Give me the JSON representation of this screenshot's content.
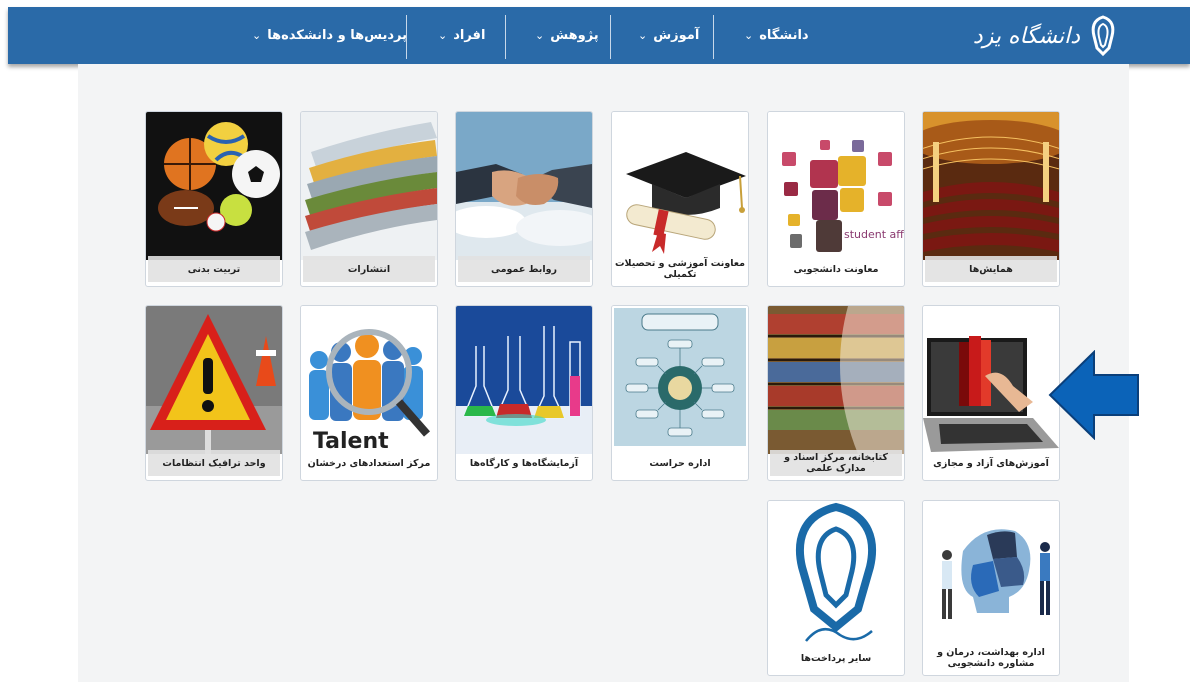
{
  "header": {
    "logo_text": "دانشگاه یزد",
    "nav": [
      {
        "label": "دانشگاه"
      },
      {
        "label": "آموزش"
      },
      {
        "label": "پژوهش"
      },
      {
        "label": "افراد"
      },
      {
        "label": "پردیس‌ها و دانشکده‌ها"
      }
    ]
  },
  "tiles": [
    {
      "label": "همایش‌ها",
      "icon": "auditorium-image"
    },
    {
      "label": "معاونت دانشجویی",
      "icon": "student-affairs-image",
      "caption": "student affairs"
    },
    {
      "label": "معاونت آموزشی و تحصیلات تکمیلی",
      "icon": "graduation-cap-image"
    },
    {
      "label": "روابط عمومی",
      "icon": "handshake-image"
    },
    {
      "label": "انتشارات",
      "icon": "magazines-image"
    },
    {
      "label": "تربیت بدنی",
      "icon": "sports-balls-image"
    },
    {
      "label": "آموزش‌های آزاد و مجازی",
      "icon": "laptop-book-image"
    },
    {
      "label": "کتابخانه، مرکز اسناد و مدارک علمی",
      "icon": "library-image"
    },
    {
      "label": "اداره حراست",
      "icon": "ornament-image"
    },
    {
      "label": "آزمایشگاه‌ها و کارگاه‌ها",
      "icon": "lab-flasks-image"
    },
    {
      "label": "مرکز استعدادهای درخشان",
      "icon": "talent-image",
      "caption": "Talent"
    },
    {
      "label": "واحد ترافیک انتظامات",
      "icon": "warning-sign-image"
    },
    {
      "label": "اداره بهداشت، درمان و مشاوره دانشجویی",
      "icon": "puzzle-head-image"
    },
    {
      "label": "سایر پرداخت‌ها",
      "icon": "university-logo-image"
    }
  ],
  "colors": {
    "header": "#2a6aa8",
    "arrow": "#0b63b8",
    "content_bg": "#f3f4f5"
  }
}
